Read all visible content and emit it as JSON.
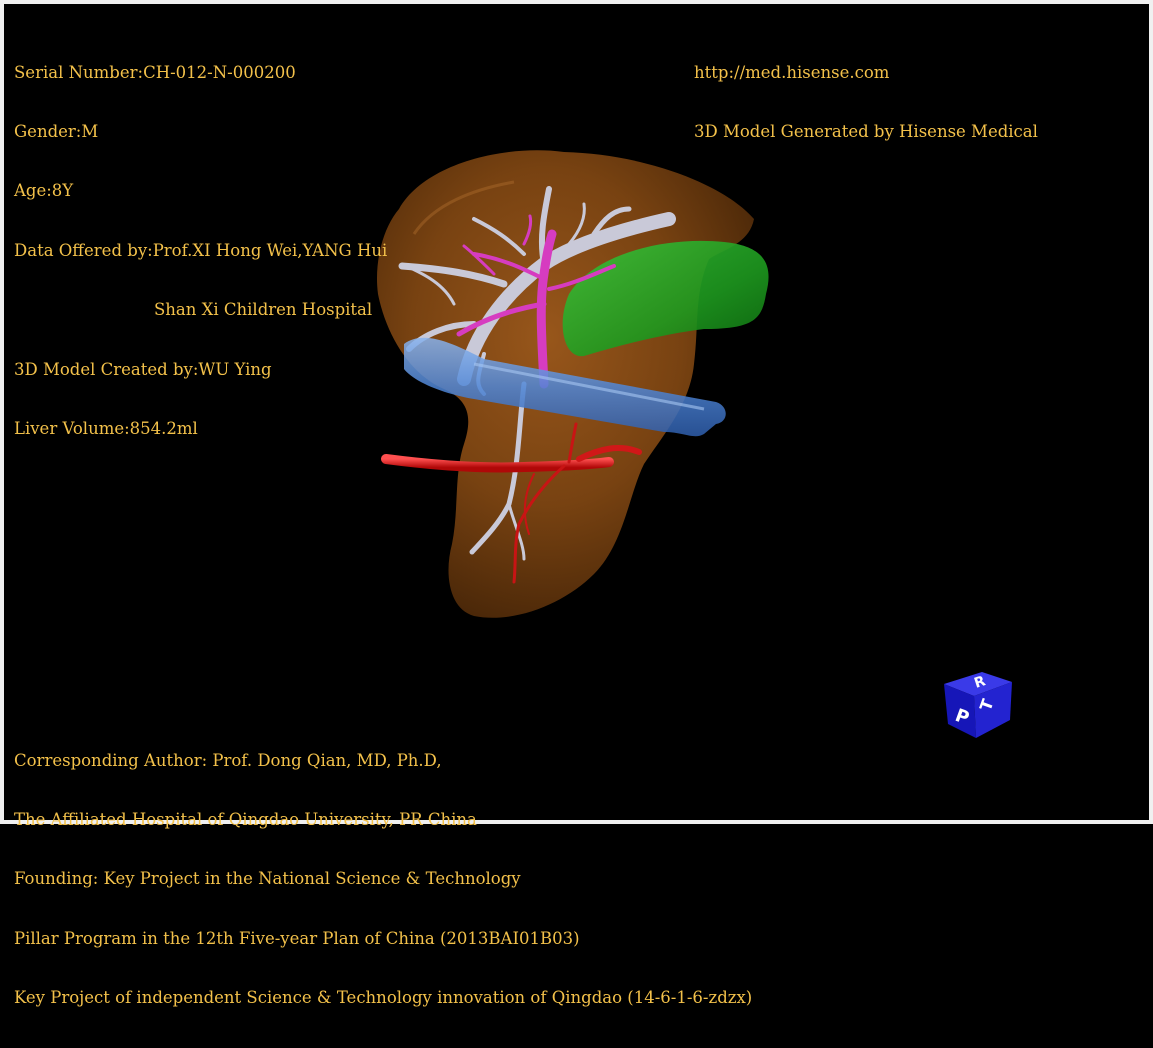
{
  "window": {
    "frame_color": "#f0f0f0",
    "background": "#000000",
    "text_color": "#f3c14a"
  },
  "info_top_left": {
    "serial_number": "Serial Number:CH-012-N-000200",
    "gender": "Gender:M",
    "age": "Age:8Y",
    "data_offered_by": "Data Offered by:Prof.XI Hong Wei,YANG Hui",
    "hospital": "Shan Xi Children Hospital",
    "model_created_by": "3D Model Created by:WU Ying",
    "liver_volume": "Liver Volume:854.2ml"
  },
  "info_top_right": {
    "url": "http://med.hisense.com",
    "generator": "3D Model Generated by Hisense Medical"
  },
  "info_bottom_left": {
    "line1": "Corresponding Author: Prof. Dong Qian, MD, Ph.D,",
    "line2": "The Affiliated Hospital of Qingdao University, PR China",
    "line3": "Founding: Key Project in the National Science & Technology",
    "line4": "Pillar Program in the 12th Five-year Plan of China (2013BAI01B03)",
    "line5": "Key Project of independent Science & Technology innovation of Qingdao (14-6-1-6-zdzx)"
  },
  "model": {
    "liver_color": "#8a4d14",
    "gallbladder_color": "#1fa51f",
    "portal_vein_color": "#c8c8d8",
    "hepatic_vein_color": "#d838c0",
    "ivc_color": "#5a8ed8",
    "artery_color": "#e01818"
  },
  "orientation_cube": {
    "face_color": "#1a1ad0",
    "labels": [
      "P",
      "R",
      "T"
    ],
    "icon": "orientation-cube-icon"
  }
}
